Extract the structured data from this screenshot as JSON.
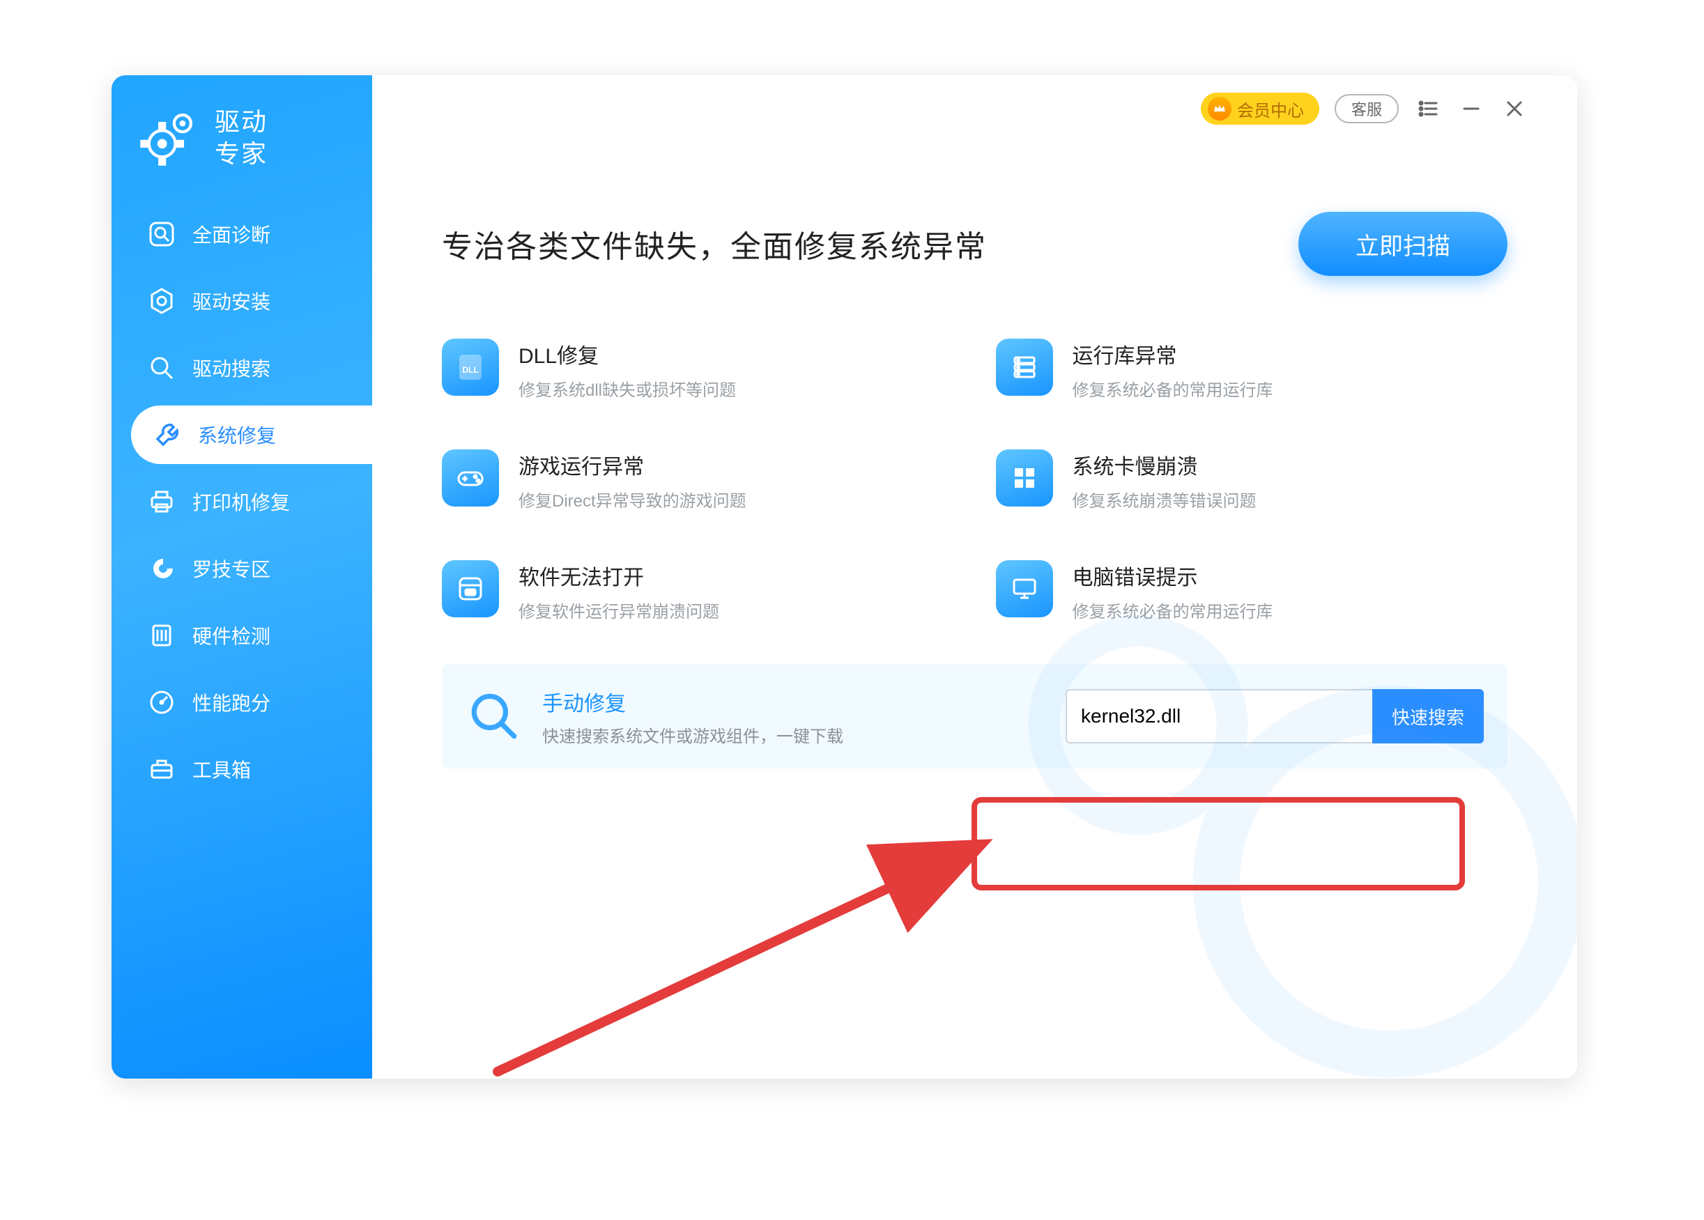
{
  "app": {
    "name_line1": "驱动",
    "name_line2": "专家"
  },
  "sidebar": {
    "items": [
      {
        "id": "diagnosis",
        "label": "全面诊断"
      },
      {
        "id": "install",
        "label": "驱动安装"
      },
      {
        "id": "search",
        "label": "驱动搜索"
      },
      {
        "id": "repair",
        "label": "系统修复"
      },
      {
        "id": "printer",
        "label": "打印机修复"
      },
      {
        "id": "logi",
        "label": "罗技专区"
      },
      {
        "id": "hw",
        "label": "硬件检测"
      },
      {
        "id": "bench",
        "label": "性能跑分"
      },
      {
        "id": "toolbox",
        "label": "工具箱"
      }
    ],
    "active_index": 3
  },
  "titlebar": {
    "vip_label": "会员中心",
    "support_label": "客服"
  },
  "hero": {
    "title": "专治各类文件缺失，全面修复系统异常",
    "scan_label": "立即扫描"
  },
  "cards": [
    {
      "title": "DLL修复",
      "desc": "修复系统dll缺失或损坏等问题"
    },
    {
      "title": "运行库异常",
      "desc": "修复系统必备的常用运行库"
    },
    {
      "title": "游戏运行异常",
      "desc": "修复Direct异常导致的游戏问题"
    },
    {
      "title": "系统卡慢崩溃",
      "desc": "修复系统崩溃等错误问题"
    },
    {
      "title": "软件无法打开",
      "desc": "修复软件运行异常崩溃问题"
    },
    {
      "title": "电脑错误提示",
      "desc": "修复系统必备的常用运行库"
    }
  ],
  "manual": {
    "title": "手动修复",
    "desc": "快速搜索系统文件或游戏组件，一键下载",
    "search_value": "kernel32.dll",
    "search_button": "快速搜索"
  },
  "colors": {
    "accent": "#1b94ff",
    "annotation_red": "#e43b3b"
  }
}
